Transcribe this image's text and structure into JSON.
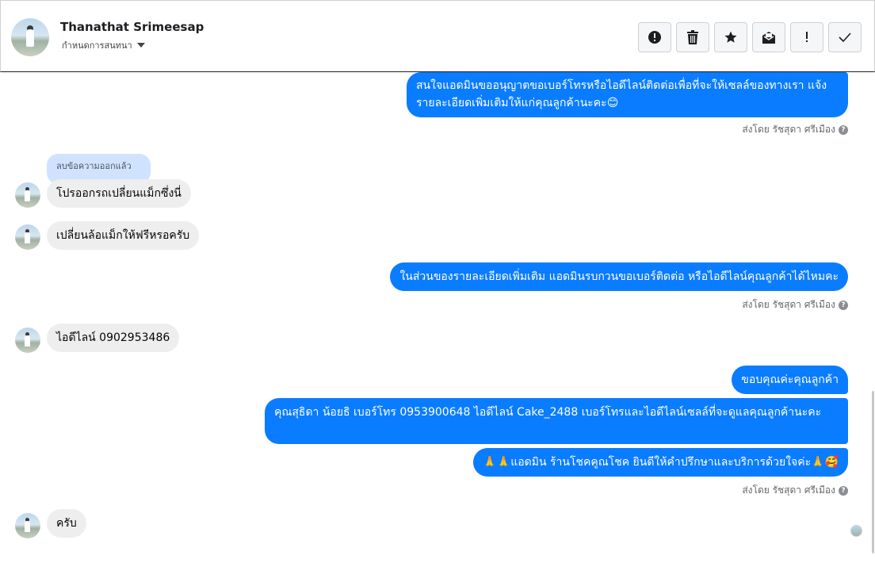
{
  "header": {
    "contact_name": "Thanathat Srimeesap",
    "subtitle": "กำหนดการสนทนา",
    "toolbar": [
      {
        "icon": "alert-icon",
        "name": "report-button"
      },
      {
        "icon": "trash-icon",
        "name": "delete-button"
      },
      {
        "icon": "star-icon",
        "name": "star-button"
      },
      {
        "icon": "mark-unread-icon",
        "name": "mark-unread-button"
      },
      {
        "icon": "exclamation-icon",
        "name": "flag-button"
      },
      {
        "icon": "check-icon",
        "name": "done-button"
      }
    ]
  },
  "messages": {
    "out1": "สนใจแอดมินขออนุญาตขอเบอร์โทรหรือไอดีไลน์ติดต่อเพื่อที่จะให้เซลล์ของทางเรา แจ้งรายละเอียดเพิ่มเติมให้แก่คุณลูกค้านะคะ😊",
    "sent_by1": "ส่งโดย รัชสุดา ศรีเมือง",
    "deleted_label": "ลบข้อความออกแล้ว",
    "in1": "โปรออกรถเปลี่ยนแม็กซึ่งนี่",
    "in2": "เปลี่ยนล้อแม็กให้ฟรีหรอครับ",
    "out2": "ในส่วนของรายละเอียดเพิ่มเติม แอดมินรบกวนขอเบอร์ติดต่อ หรือไอดีไลน์คุณลูกค้าได้ไหมคะ",
    "sent_by2": "ส่งโดย รัชสุดา ศรีเมือง",
    "in3": "ไอดีไลน์ 0902953486",
    "out3": "ขอบคุณค่ะคุณลูกค้า",
    "out4": "คุณสุธิดา น้อยธิ       เบอร์โทร 0953900648  ไอดีไลน์ Cake_2488   เบอร์โทรและไอดีไลน์เซลล์ที่จะดูแลคุณลูกค้านะคะ",
    "out5": "🙏🙏แอดมิน ร้านโชคคูณโชค ยินดีให้คำปรึกษาและบริการด้วยใจค่ะ🙏🥰",
    "sent_by3": "ส่งโดย รัชสุดา ศรีเมือง",
    "in4": "ครับ",
    "help_glyph": "?"
  },
  "colors": {
    "outgoing": "#0a7cff",
    "incoming": "#eeeeee",
    "deleted_tag": "#cfe3ff"
  }
}
